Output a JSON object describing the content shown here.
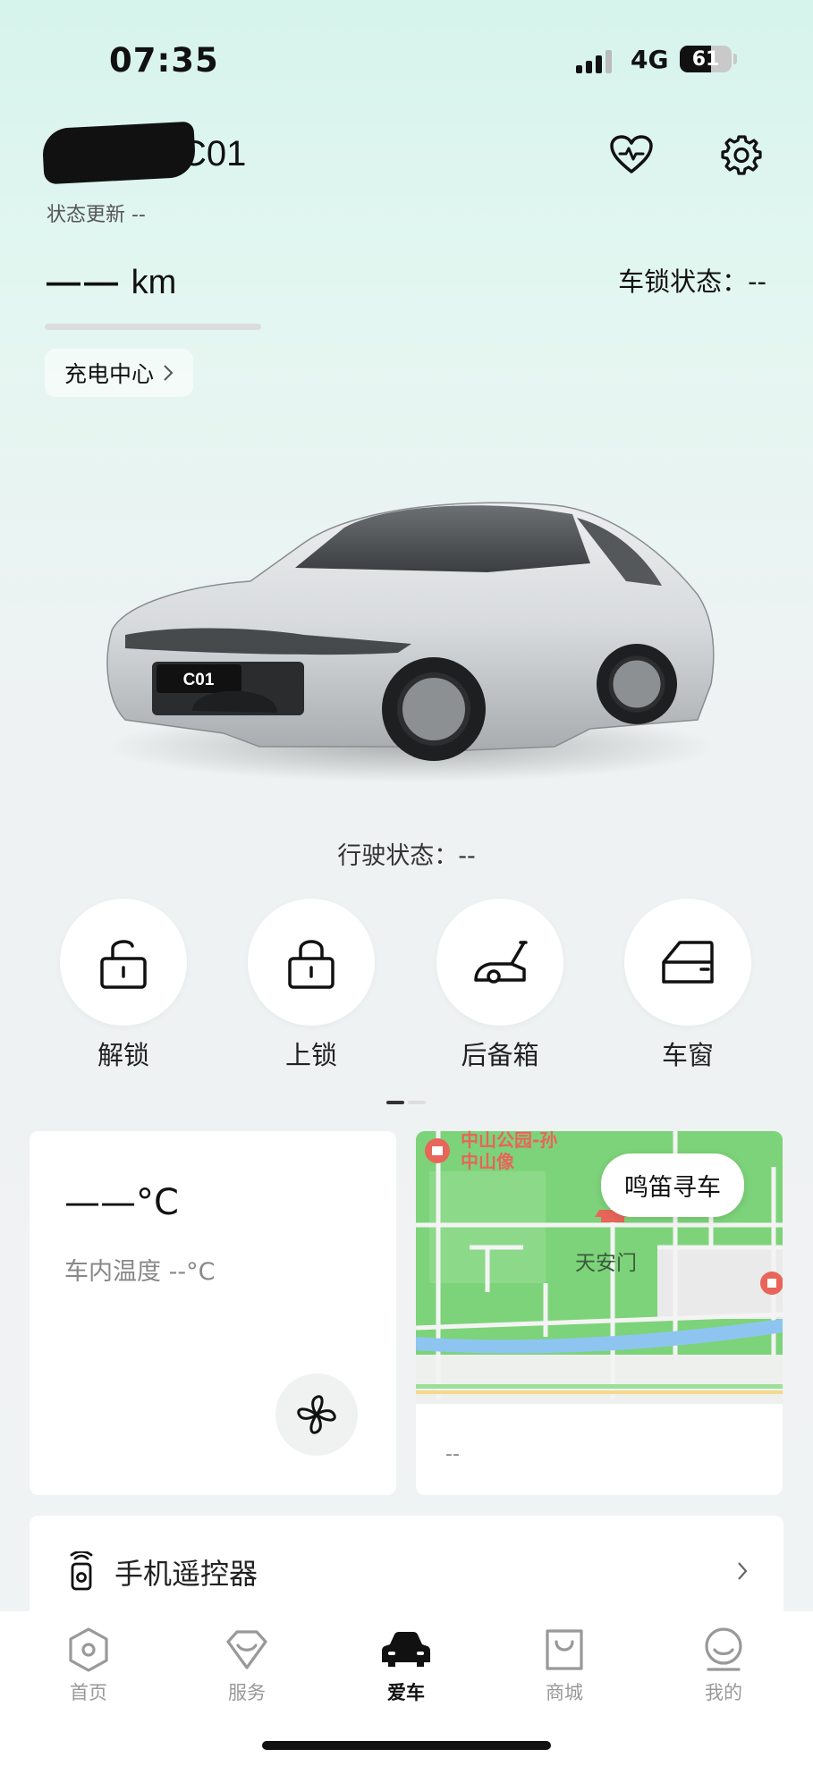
{
  "status_bar": {
    "time": "07:35",
    "network": "4G",
    "battery": "61",
    "battery_level": 0.61
  },
  "header": {
    "car_name": "C01",
    "status_update": "状态更新 --",
    "health_icon": "heart-pulse-icon",
    "settings_icon": "gear-icon"
  },
  "range": {
    "value": "——",
    "unit": "km"
  },
  "lock_status": "车锁状态：--",
  "charge_center": "充电中心",
  "plate_text": "C01",
  "drive_status": "行驶状态：--",
  "controls": [
    {
      "label": "解锁",
      "icon": "unlock-icon"
    },
    {
      "label": "上锁",
      "icon": "lock-icon"
    },
    {
      "label": "后备箱",
      "icon": "trunk-icon"
    },
    {
      "label": "车窗",
      "icon": "window-icon"
    }
  ],
  "climate": {
    "temp": "——°C",
    "inside_label": "车内温度 --°C",
    "fan_icon": "fan-icon"
  },
  "map": {
    "poi_1": "中山公园-孙",
    "poi_2": "中山像",
    "landmark": "天安门",
    "honk_label": "鸣笛寻车",
    "location_text": "--"
  },
  "remote": {
    "label": "手机遥控器",
    "icon": "remote-control-icon"
  },
  "tabs": [
    {
      "label": "首页",
      "icon": "home-hexagon-icon",
      "active": false
    },
    {
      "label": "服务",
      "icon": "service-diamond-icon",
      "active": false
    },
    {
      "label": "爱车",
      "icon": "car-icon",
      "active": true
    },
    {
      "label": "商城",
      "icon": "shopping-bag-icon",
      "active": false
    },
    {
      "label": "我的",
      "icon": "profile-icon",
      "active": false
    }
  ],
  "colors": {
    "accent_gradient_top": "#d6f4ec",
    "map_green": "#7cd37c",
    "map_river": "#8ec5f0",
    "active_tab": "#111111"
  }
}
